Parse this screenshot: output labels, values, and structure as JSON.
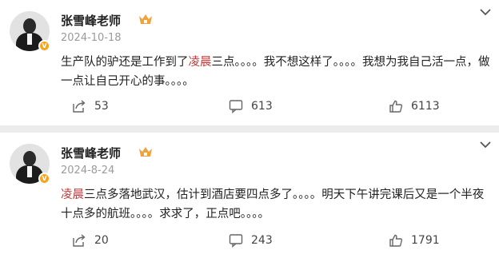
{
  "posts": [
    {
      "author": "张雪峰老师",
      "date": "2024-10-18",
      "text_parts": [
        "生产队的驴还是工作到了",
        "凌晨",
        "三点。。。。我不想这样了。。。。我想为我自己活一点，做一点让自己开心的事。。。。"
      ],
      "shares": "53",
      "comments": "613",
      "likes": "6113"
    },
    {
      "author": "张雪峰老师",
      "date": "2024-8-24",
      "text_parts": [
        "",
        "凌晨",
        "三点多落地武汉，估计到酒店要四点多了。。。。明天下午讲完课后又是一个半夜十点多的航班。。。。求求了，正点吧。。。。"
      ],
      "shares": "20",
      "comments": "243",
      "likes": "1791"
    }
  ],
  "icons": {
    "share": "share-icon",
    "comment": "comment-icon",
    "like": "like-icon",
    "more": "chevron-down-icon",
    "crown": "crown-badge-icon",
    "verified": "verified-v-icon"
  },
  "colors": {
    "highlight": "#c23a3a",
    "verified": "#f7a51c",
    "crown": "#f2a23a"
  },
  "verified_mark": "V"
}
